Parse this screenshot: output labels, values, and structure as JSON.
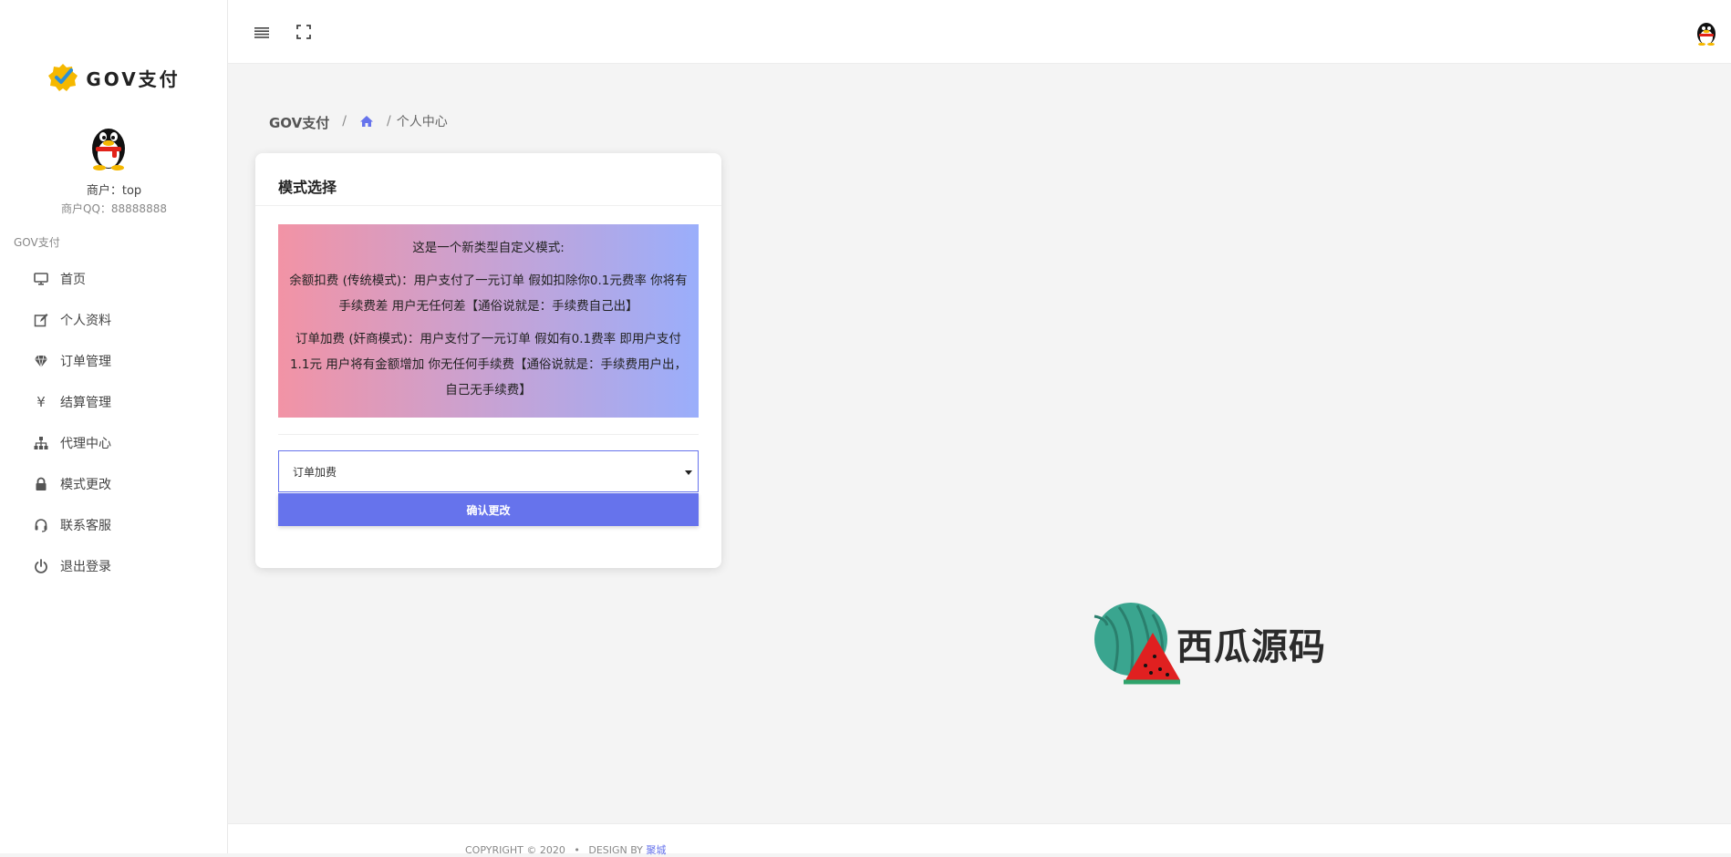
{
  "brand": {
    "name": "GOV支付",
    "logo_icon": "check-badge-icon"
  },
  "profile": {
    "merchant_label": "商户：top",
    "qq_label": "商户QQ：88888888",
    "avatar_icon": "qq-penguin-icon"
  },
  "sidebar": {
    "heading": "GOV支付",
    "items": [
      {
        "label": "首页",
        "icon": "monitor-icon"
      },
      {
        "label": "个人资料",
        "icon": "edit-icon"
      },
      {
        "label": "订单管理",
        "icon": "diamond-icon"
      },
      {
        "label": "结算管理",
        "icon": "yen-icon"
      },
      {
        "label": "代理中心",
        "icon": "sitemap-icon"
      },
      {
        "label": "模式更改",
        "icon": "lock-icon"
      },
      {
        "label": "联系客服",
        "icon": "headset-icon"
      },
      {
        "label": "退出登录",
        "icon": "power-icon"
      }
    ]
  },
  "header": {
    "menu_icon": "hamburger-icon",
    "fullscreen_icon": "fullscreen-icon"
  },
  "breadcrumb": {
    "root": "GOV支付",
    "home_icon": "home-icon",
    "sep": "/",
    "current": "个人中心"
  },
  "card": {
    "title": "模式选择",
    "info_lines": [
      "这是一个新类型自定义模式:",
      "余额扣费 (传统模式)：用户支付了一元订单 假如扣除你0.1元费率 你将有手续费差 用户无任何差【通俗说就是：手续费自己出】",
      "订单加费 (奸商模式)：用户支付了一元订单 假如有0.1费率 即用户支付1.1元 用户将有金额增加 你无任何手续费【通俗说就是：手续费用户出，自己无手续费】"
    ],
    "select_value": "订单加费",
    "confirm_label": "确认更改",
    "colors": {
      "accent": "#6673ec",
      "gradient_start": "#f293a5",
      "gradient_end": "#9aaefb"
    }
  },
  "watermark": {
    "text": "西瓜源码",
    "icon": "watermelon-icon"
  },
  "footer": {
    "copyright": "COPYRIGHT © 2020",
    "dot": "•",
    "design_by": "DESIGN BY",
    "author": "聚城"
  }
}
